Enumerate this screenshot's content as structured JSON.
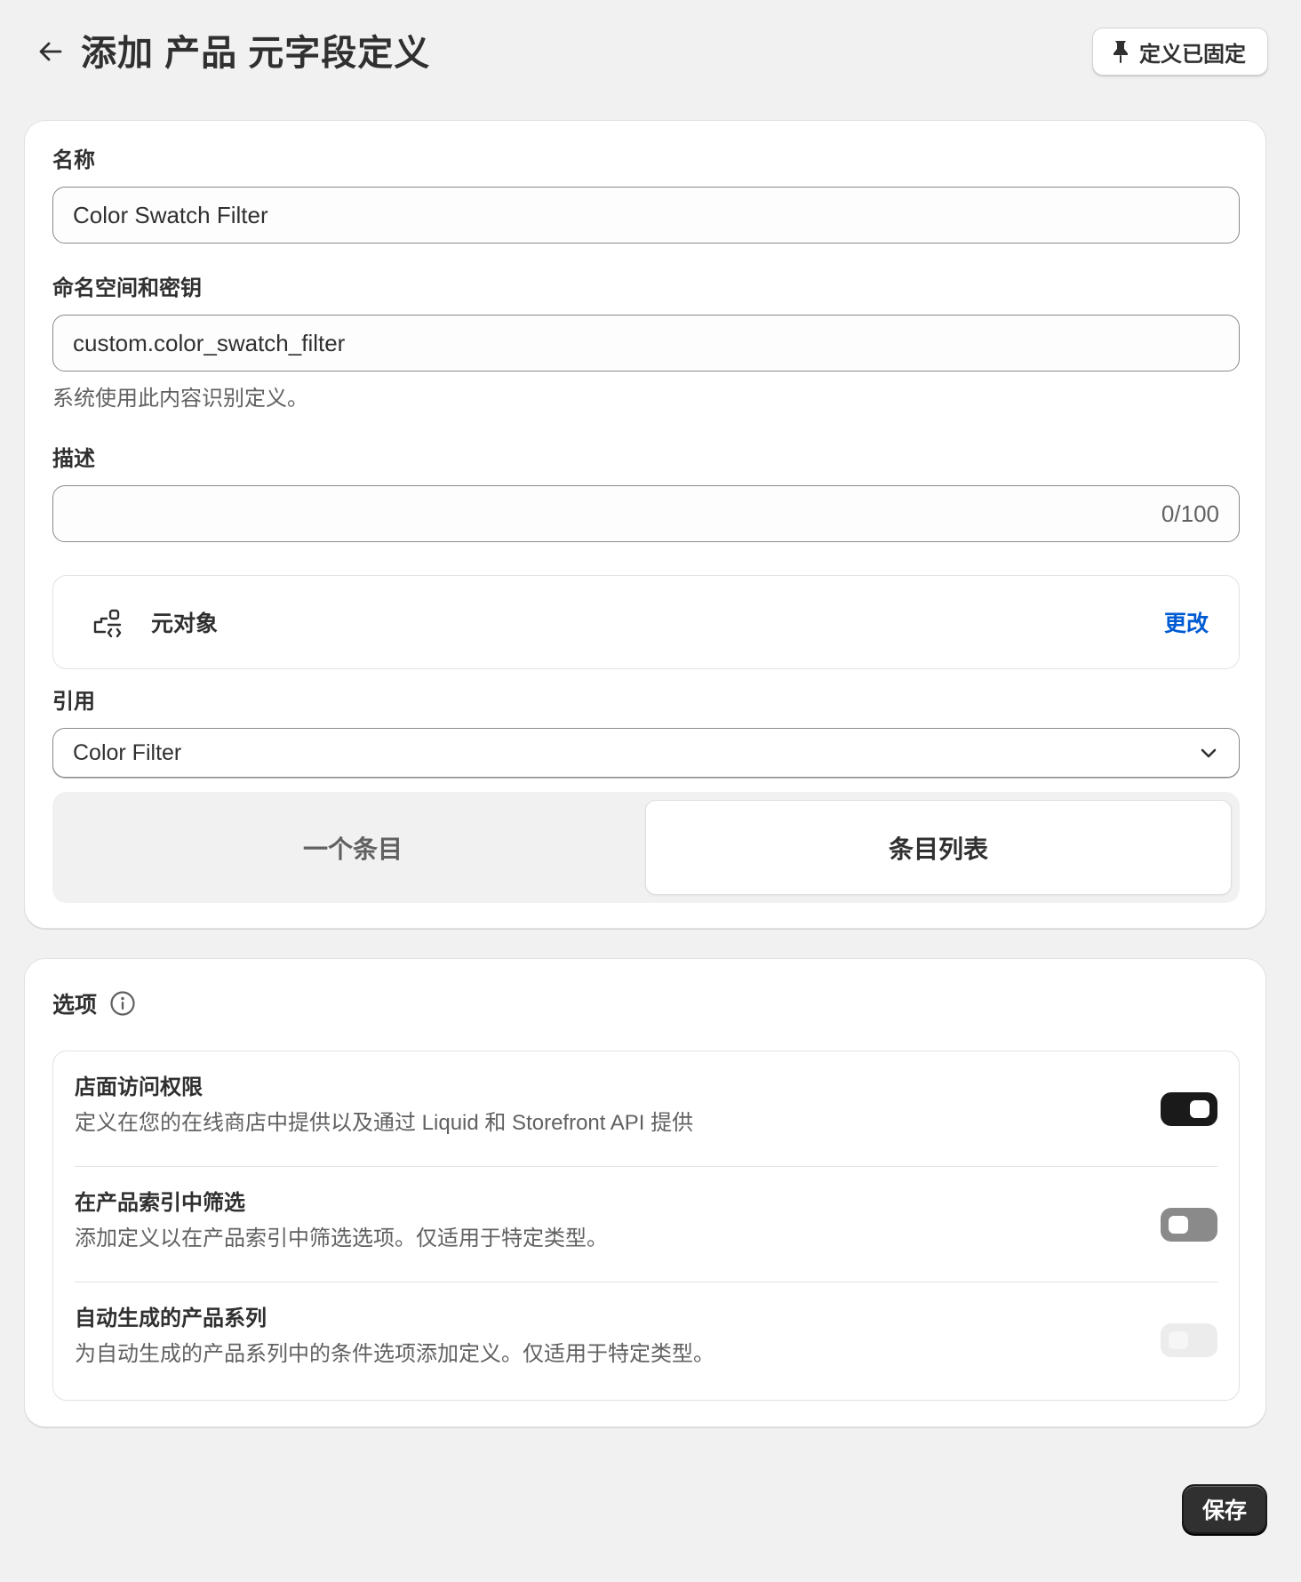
{
  "header": {
    "title": "添加 产品 元字段定义",
    "pin_label": "定义已固定"
  },
  "form": {
    "name_label": "名称",
    "name_value": "Color Swatch Filter",
    "namespace_label": "命名空间和密钥",
    "namespace_value": "custom.color_swatch_filter",
    "namespace_help": "系统使用此内容识别定义。",
    "description_label": "描述",
    "description_value": "",
    "description_counter": "0/100",
    "type_label": "元对象",
    "type_change": "更改",
    "reference_label": "引用",
    "reference_value": "Color Filter",
    "segments": [
      "一个条目",
      "条目列表"
    ],
    "selected_segment": "条目列表"
  },
  "options": {
    "title": "选项",
    "items": [
      {
        "title": "店面访问权限",
        "description": "定义在您的在线商店中提供以及通过 Liquid 和 Storefront API 提供",
        "state": "on"
      },
      {
        "title": "在产品索引中筛选",
        "description": "添加定义以在产品索引中筛选选项。仅适用于特定类型。",
        "state": "off"
      },
      {
        "title": "自动生成的产品系列",
        "description": "为自动生成的产品系列中的条件选项添加定义。仅适用于特定类型。",
        "state": "disabled"
      }
    ]
  },
  "footer": {
    "save_label": "保存"
  },
  "colors": {
    "background": "#f1f1f1",
    "link": "#005bd3",
    "primary_button": "#303030",
    "toggle_on": "#1a1a1a"
  },
  "icons": {
    "back": "arrow-left-icon",
    "pin": "pin-icon",
    "type": "metaobject-icon",
    "select": "chevron-down-icon",
    "info": "info-icon"
  }
}
